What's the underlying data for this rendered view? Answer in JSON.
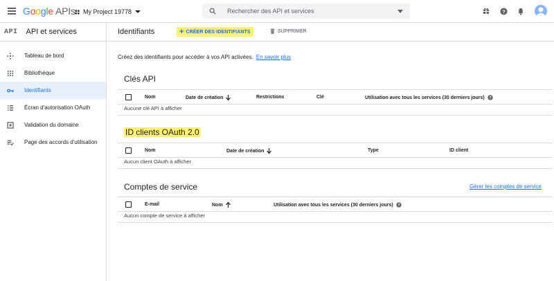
{
  "topbar": {
    "logo_google": [
      "G",
      "o",
      "o",
      "g",
      "l",
      "e"
    ],
    "logo_apis": "APIs",
    "project_name": "My Project 19778",
    "search_placeholder": "Rechercher des API et services",
    "icons": [
      "gift-icon",
      "help-icon",
      "notifications-icon",
      "avatar"
    ]
  },
  "sidebar": {
    "badge": "API",
    "title": "API et services",
    "items": [
      {
        "label": "Tableau de bord",
        "icon": "dashboard-icon"
      },
      {
        "label": "Bibliothèque",
        "icon": "library-icon"
      },
      {
        "label": "Identifiants",
        "icon": "key-icon",
        "active": true
      },
      {
        "label": "Écran d'autorisation OAuth",
        "icon": "consent-icon"
      },
      {
        "label": "Validation du domaine",
        "icon": "domain-icon"
      },
      {
        "label": "Page des accords d'utilisation",
        "icon": "agreements-icon"
      }
    ]
  },
  "main": {
    "title": "Identifiants",
    "create_label": "CRÉER DES IDENTIFIANTS",
    "delete_label": "SUPPRIMER",
    "intro_text": "Créez des identifiants pour accéder à vos API activées.",
    "intro_link": "En savoir plus",
    "api_keys": {
      "title": "Clés API",
      "columns": [
        "Nom",
        "Date de création",
        "Restrictions",
        "Clé",
        "Utilisation avec tous les services (30 derniers jours)"
      ],
      "empty": "Aucune clé API à afficher"
    },
    "oauth": {
      "title": "ID clients OAuth 2.0",
      "columns": [
        "Nom",
        "Date de création",
        "Type",
        "ID client"
      ],
      "empty": "Aucun client OAuth à afficher"
    },
    "service_accounts": {
      "title": "Comptes de service",
      "link": "Gérer les comptes de service",
      "columns": [
        "E-mail",
        "Nom",
        "Utilisation avec tous les services (30 derniers jours)"
      ],
      "empty": "Aucun compte de service à afficher"
    }
  },
  "colors": {
    "accent": "#1a73e8",
    "highlight": "#fff176",
    "active_bg": "#e8f0fe"
  }
}
